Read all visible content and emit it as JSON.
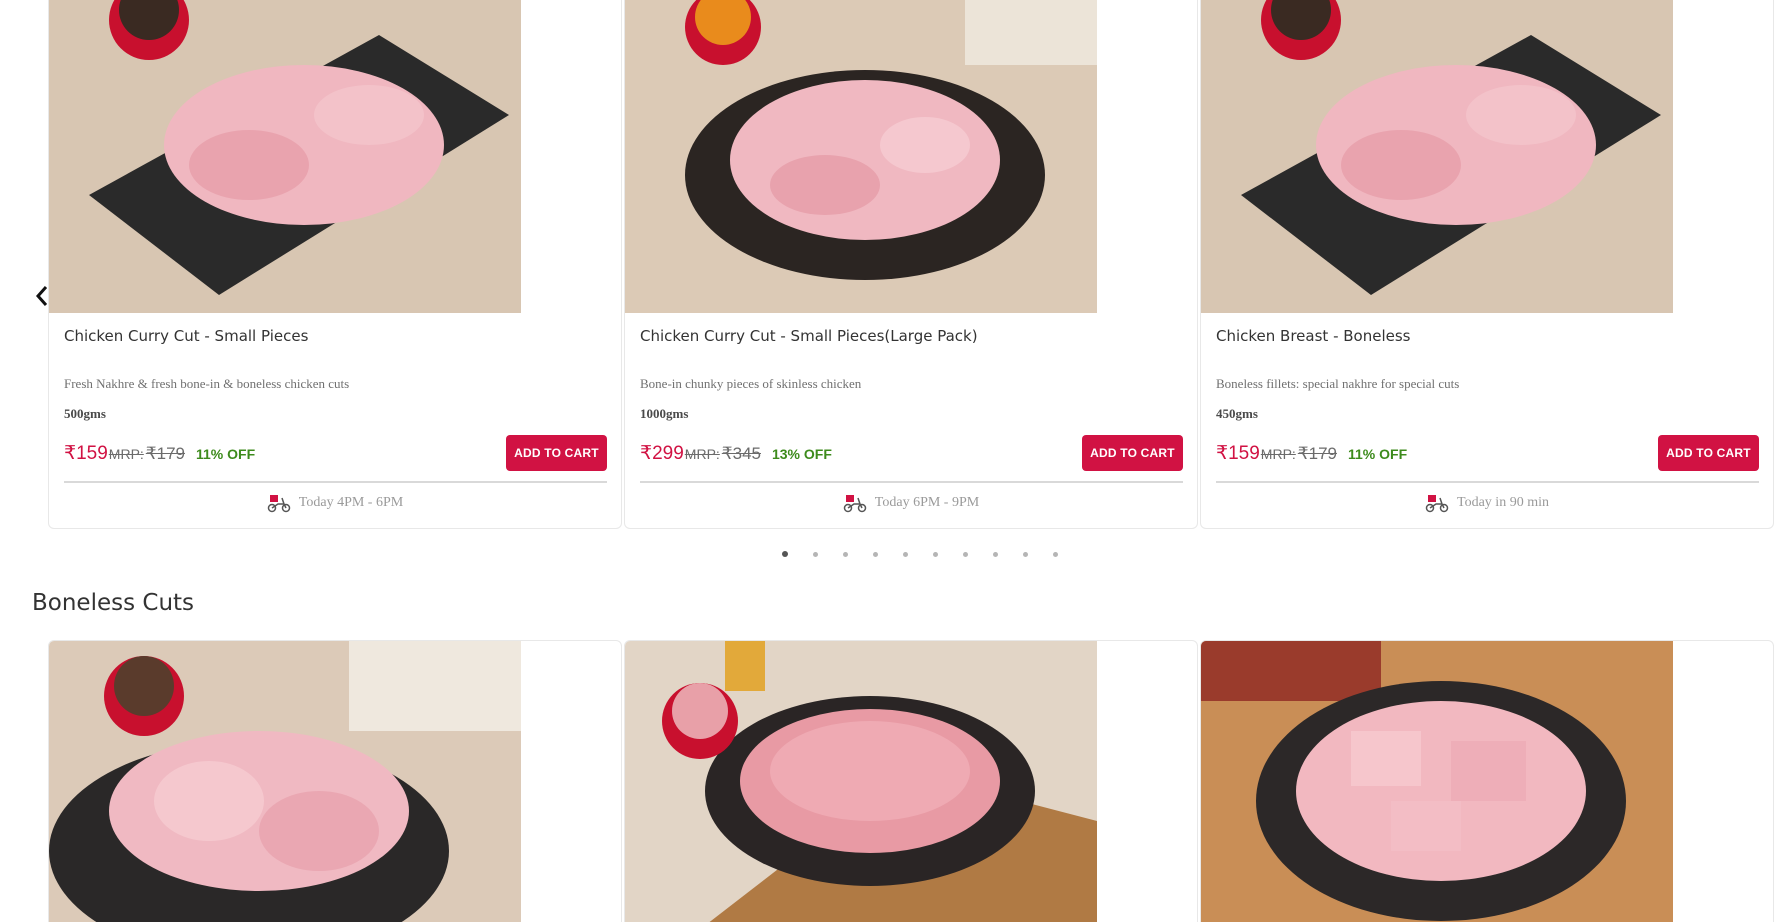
{
  "carousel": {
    "prev_arrow_icon": "chevron-left-icon",
    "dots_count": 10,
    "active_dot": 0,
    "products": [
      {
        "name": "Chicken Curry Cut - Small Pieces",
        "description": "Fresh Nakhre & fresh bone-in & boneless chicken cuts",
        "weight": "500gms",
        "price": "₹159",
        "mrp_label": "MRP: ",
        "mrp": "₹179",
        "discount": "11% OFF",
        "button": "ADD TO CART",
        "delivery": "Today 4PM - 6PM",
        "image": "chicken-curry-cut-slate-photo"
      },
      {
        "name": "Chicken Curry Cut - Small Pieces(Large Pack)",
        "description": "Bone-in chunky pieces of skinless chicken",
        "weight": "1000gms",
        "price": "₹299",
        "mrp_label": "MRP: ",
        "mrp": "₹345",
        "discount": "13% OFF",
        "button": "ADD TO CART",
        "delivery": "Today 6PM - 9PM",
        "image": "chicken-curry-cut-plate-photo"
      },
      {
        "name": "Chicken Breast - Boneless",
        "description": "Boneless fillets: special nakhre for special cuts",
        "weight": "450gms",
        "price": "₹159",
        "mrp_label": "MRP: ",
        "mrp": "₹179",
        "discount": "11% OFF",
        "button": "ADD TO CART",
        "delivery": "Today in 90 min",
        "image": "chicken-breast-slate-photo"
      }
    ]
  },
  "boneless_section": {
    "title": "Boneless Cuts",
    "products": [
      {
        "image": "boneless-chicken-thigh-photo"
      },
      {
        "image": "chicken-mince-photo"
      },
      {
        "image": "boneless-fish-cubes-photo"
      }
    ]
  },
  "colors": {
    "accent": "#d11243",
    "discount": "#3d8b1c",
    "background_photo": "#d9c8b4"
  }
}
